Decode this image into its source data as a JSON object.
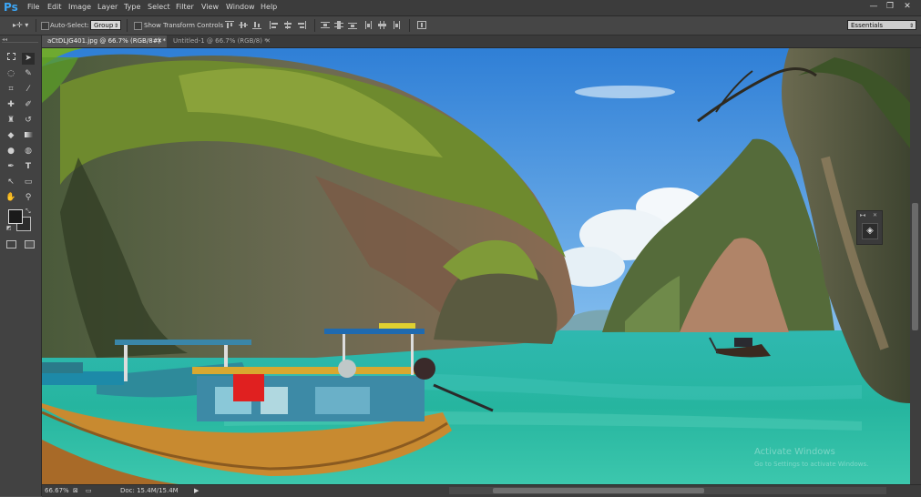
{
  "app": {
    "logo": "Ps"
  },
  "menu": [
    "File",
    "Edit",
    "Image",
    "Layer",
    "Type",
    "Select",
    "Filter",
    "View",
    "Window",
    "Help"
  ],
  "window_controls": {
    "minimize": "—",
    "restore": "❐",
    "close": "✕"
  },
  "options": {
    "tool_arrow": "▸✛ ▾",
    "auto_select_label": "Auto-Select:",
    "auto_select_value": "Group",
    "show_transform_label": "Show Transform Controls",
    "workspace": "Essentials"
  },
  "tabs": [
    {
      "label": "aCtDLJG401.jpg @ 66.7% (RGB/8#) *",
      "close": "✕",
      "active": true
    },
    {
      "label": "Untitled-1 @ 66.7% (RGB/8) *",
      "close": "✕",
      "active": false
    }
  ],
  "status": {
    "zoom": "66.67%",
    "doc": "Doc: 15.4M/15.4M",
    "arrow": "▶",
    "watermark_title": "Activate Windows",
    "watermark_sub": "Go to Settings to activate Windows."
  },
  "tool_icons": [
    "move-tool-icon",
    "marquee-tool-icon",
    "lasso-tool-icon",
    "quick-select-tool-icon",
    "crop-tool-icon",
    "eyedropper-tool-icon",
    "healing-brush-icon",
    "brush-tool-icon",
    "clone-stamp-icon",
    "history-brush-icon",
    "eraser-tool-icon",
    "gradient-tool-icon",
    "blur-tool-icon",
    "dodge-tool-icon",
    "pen-tool-icon",
    "type-tool-icon",
    "path-select-icon",
    "shape-tool-icon",
    "hand-tool-icon",
    "zoom-tool-icon"
  ],
  "colors": {
    "accent": "#3ca6f5",
    "foreground": "#1a1a1a",
    "background": "#2c2c2c"
  }
}
